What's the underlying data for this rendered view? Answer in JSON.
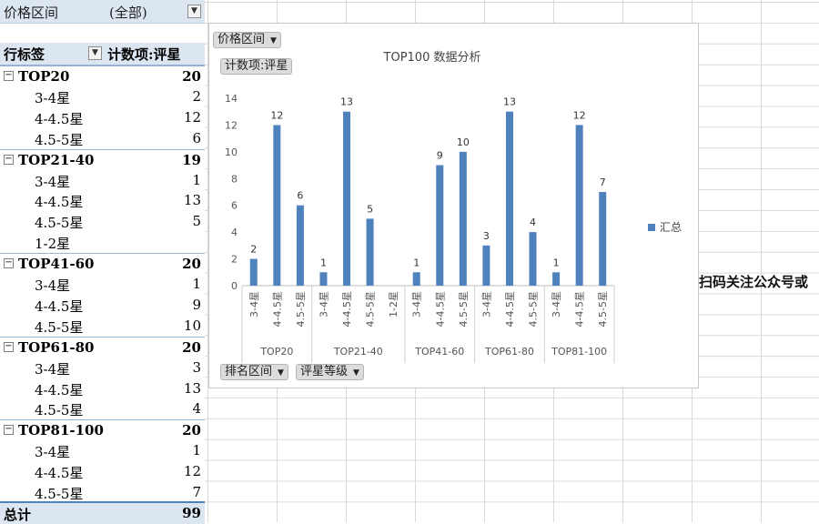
{
  "filter": {
    "label": "价格区间",
    "value": "(全部)"
  },
  "header": {
    "row_label": "行标签",
    "count_label": "计数项:评星"
  },
  "groups": [
    {
      "name": "TOP20",
      "total": "20",
      "items": [
        {
          "name": "3-4星",
          "count": "2"
        },
        {
          "name": "4-4.5星",
          "count": "12"
        },
        {
          "name": "4.5-5星",
          "count": "6"
        }
      ]
    },
    {
      "name": "TOP21-40",
      "total": "19",
      "items": [
        {
          "name": "3-4星",
          "count": "1"
        },
        {
          "name": "4-4.5星",
          "count": "13"
        },
        {
          "name": "4.5-5星",
          "count": "5"
        },
        {
          "name": "1-2星",
          "count": ""
        }
      ]
    },
    {
      "name": "TOP41-60",
      "total": "20",
      "items": [
        {
          "name": "3-4星",
          "count": "1"
        },
        {
          "name": "4-4.5星",
          "count": "9"
        },
        {
          "name": "4.5-5星",
          "count": "10"
        }
      ]
    },
    {
      "name": "TOP61-80",
      "total": "20",
      "items": [
        {
          "name": "3-4星",
          "count": "3"
        },
        {
          "name": "4-4.5星",
          "count": "13"
        },
        {
          "name": "4.5-5星",
          "count": "4"
        }
      ]
    },
    {
      "name": "TOP81-100",
      "total": "20",
      "items": [
        {
          "name": "3-4星",
          "count": "1"
        },
        {
          "name": "4-4.5星",
          "count": "12"
        },
        {
          "name": "4.5-5星",
          "count": "7"
        }
      ]
    }
  ],
  "total": {
    "label": "总计",
    "value": "99"
  },
  "chart_buttons": {
    "price_filter": "价格区间",
    "value_field": "计数项:评星",
    "rank_axis": "排名区间",
    "rating_axis": "评星等级"
  },
  "side_text": "扫码关注公众号或",
  "chart_data": {
    "type": "bar",
    "title": "TOP100 数据分析",
    "ylim": [
      0,
      14
    ],
    "yticks": [
      0,
      2,
      4,
      6,
      8,
      10,
      12,
      14
    ],
    "grid": false,
    "legend": {
      "position": "right",
      "entries": [
        "汇总"
      ]
    },
    "color": "#4f81bd",
    "groups": [
      {
        "name": "TOP20",
        "categories": [
          "3-4星",
          "4-4.5星",
          "4.5-5星"
        ],
        "values": [
          2,
          12,
          6
        ]
      },
      {
        "name": "TOP21-40",
        "categories": [
          "3-4星",
          "4-4.5星",
          "4.5-5星",
          "1-2星"
        ],
        "values": [
          1,
          13,
          5,
          null
        ]
      },
      {
        "name": "TOP41-60",
        "categories": [
          "3-4星",
          "4-4.5星",
          "4.5-5星"
        ],
        "values": [
          1,
          9,
          10
        ]
      },
      {
        "name": "TOP61-80",
        "categories": [
          "3-4星",
          "4-4.5星",
          "4.5-5星"
        ],
        "values": [
          3,
          13,
          4
        ]
      },
      {
        "name": "TOP81-100",
        "categories": [
          "3-4星",
          "4-4.5星",
          "4.5-5星"
        ],
        "values": [
          1,
          12,
          7
        ]
      }
    ]
  }
}
